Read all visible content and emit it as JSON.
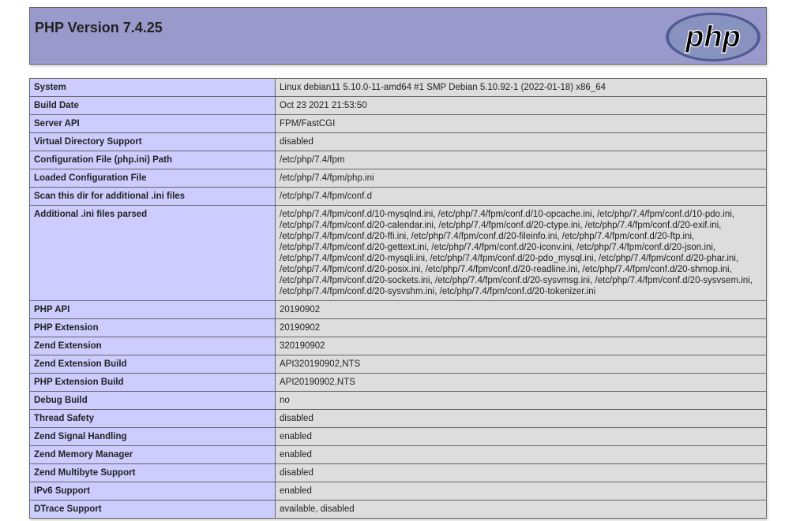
{
  "header": {
    "title": "PHP Version 7.4.25",
    "logo_text": "php"
  },
  "rows": [
    {
      "label": "System",
      "value": "Linux debian11 5.10.0-11-amd64 #1 SMP Debian 5.10.92-1 (2022-01-18) x86_64"
    },
    {
      "label": "Build Date",
      "value": "Oct 23 2021 21:53:50"
    },
    {
      "label": "Server API",
      "value": "FPM/FastCGI"
    },
    {
      "label": "Virtual Directory Support",
      "value": "disabled"
    },
    {
      "label": "Configuration File (php.ini) Path",
      "value": "/etc/php/7.4/fpm"
    },
    {
      "label": "Loaded Configuration File",
      "value": "/etc/php/7.4/fpm/php.ini"
    },
    {
      "label": "Scan this dir for additional .ini files",
      "value": "/etc/php/7.4/fpm/conf.d"
    },
    {
      "label": "Additional .ini files parsed",
      "value": "/etc/php/7.4/fpm/conf.d/10-mysqlnd.ini, /etc/php/7.4/fpm/conf.d/10-opcache.ini, /etc/php/7.4/fpm/conf.d/10-pdo.ini, /etc/php/7.4/fpm/conf.d/20-calendar.ini, /etc/php/7.4/fpm/conf.d/20-ctype.ini, /etc/php/7.4/fpm/conf.d/20-exif.ini, /etc/php/7.4/fpm/conf.d/20-ffi.ini, /etc/php/7.4/fpm/conf.d/20-fileinfo.ini, /etc/php/7.4/fpm/conf.d/20-ftp.ini, /etc/php/7.4/fpm/conf.d/20-gettext.ini, /etc/php/7.4/fpm/conf.d/20-iconv.ini, /etc/php/7.4/fpm/conf.d/20-json.ini, /etc/php/7.4/fpm/conf.d/20-mysqli.ini, /etc/php/7.4/fpm/conf.d/20-pdo_mysql.ini, /etc/php/7.4/fpm/conf.d/20-phar.ini, /etc/php/7.4/fpm/conf.d/20-posix.ini, /etc/php/7.4/fpm/conf.d/20-readline.ini, /etc/php/7.4/fpm/conf.d/20-shmop.ini, /etc/php/7.4/fpm/conf.d/20-sockets.ini, /etc/php/7.4/fpm/conf.d/20-sysvmsg.ini, /etc/php/7.4/fpm/conf.d/20-sysvsem.ini, /etc/php/7.4/fpm/conf.d/20-sysvshm.ini, /etc/php/7.4/fpm/conf.d/20-tokenizer.ini"
    },
    {
      "label": "PHP API",
      "value": "20190902"
    },
    {
      "label": "PHP Extension",
      "value": "20190902"
    },
    {
      "label": "Zend Extension",
      "value": "320190902"
    },
    {
      "label": "Zend Extension Build",
      "value": "API320190902,NTS"
    },
    {
      "label": "PHP Extension Build",
      "value": "API20190902,NTS"
    },
    {
      "label": "Debug Build",
      "value": "no"
    },
    {
      "label": "Thread Safety",
      "value": "disabled"
    },
    {
      "label": "Zend Signal Handling",
      "value": "enabled"
    },
    {
      "label": "Zend Memory Manager",
      "value": "enabled"
    },
    {
      "label": "Zend Multibyte Support",
      "value": "disabled"
    },
    {
      "label": "IPv6 Support",
      "value": "enabled"
    },
    {
      "label": "DTrace Support",
      "value": "available, disabled"
    }
  ]
}
